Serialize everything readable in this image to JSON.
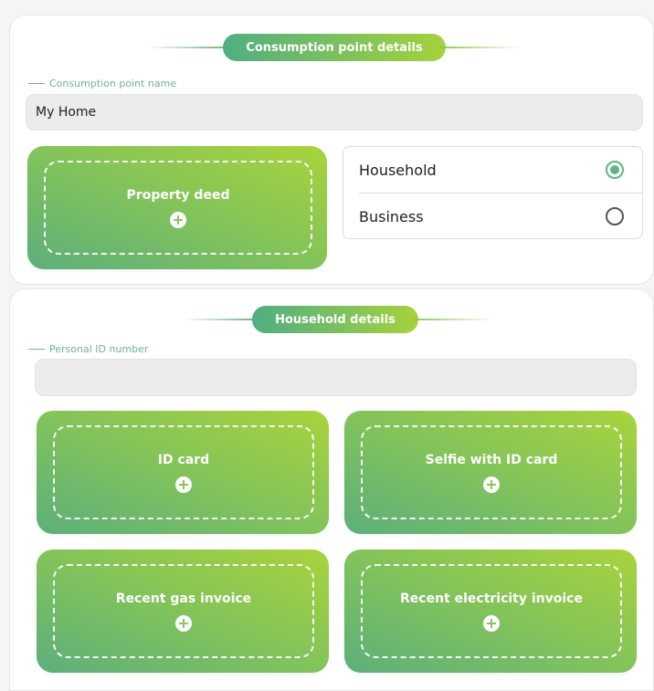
{
  "consumption_point": {
    "section_title": "Consumption point details",
    "name_label": "Consumption point name",
    "name_value": "My Home",
    "property_deed_label": "Property deed",
    "type_options": [
      {
        "label": "Household",
        "selected": true
      },
      {
        "label": "Business",
        "selected": false
      }
    ]
  },
  "household": {
    "section_title": "Household details",
    "personal_id_label": "Personal ID number",
    "personal_id_value": "",
    "documents": [
      {
        "label": "ID card"
      },
      {
        "label": "Selfie with ID card"
      },
      {
        "label": "Recent gas invoice"
      },
      {
        "label": "Recent electricity invoice"
      }
    ]
  },
  "colors": {
    "accent_green": "#5cb87e",
    "accent_lime": "#a6d23c"
  },
  "icons": {
    "upload": "plus-circle-icon",
    "radio_checked": "radio-checked-icon",
    "radio_unchecked": "radio-unchecked-icon"
  }
}
